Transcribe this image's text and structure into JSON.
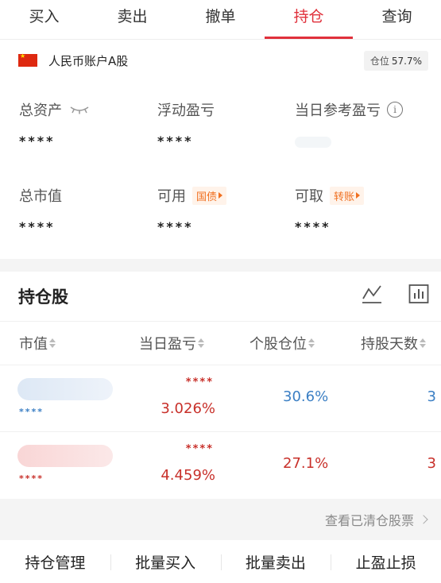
{
  "tabs": [
    {
      "label": "买入"
    },
    {
      "label": "卖出"
    },
    {
      "label": "撤单"
    },
    {
      "label": "持仓"
    },
    {
      "label": "查询"
    }
  ],
  "account": {
    "name": "人民币账户A股",
    "position_label": "仓位",
    "position_pct": "57.7%"
  },
  "assets": {
    "total_assets": {
      "label": "总资产",
      "value": "****"
    },
    "floating_pnl": {
      "label": "浮动盈亏",
      "value": "****"
    },
    "today_ref_pnl": {
      "label": "当日参考盈亏"
    },
    "market_value": {
      "label": "总市值",
      "value": "****"
    },
    "available": {
      "label": "可用",
      "tag": "国债",
      "value": "****"
    },
    "withdrawable": {
      "label": "可取",
      "tag": "转账",
      "value": "****"
    }
  },
  "holdings": {
    "title": "持仓股",
    "columns": [
      "市值",
      "当日盈亏",
      "个股仓位",
      "持股天数"
    ],
    "rows": [
      {
        "code": "****",
        "pnl_amount": "****",
        "pnl_pct": "3.026%",
        "position": "30.6%",
        "days": "3"
      },
      {
        "code": "****",
        "pnl_amount": "****",
        "pnl_pct": "4.459%",
        "position": "27.1%",
        "days": "3"
      }
    ],
    "cleared_link": "查看已清仓股票"
  },
  "actions": [
    "持仓管理",
    "批量买入",
    "批量卖出",
    "止盈止损"
  ],
  "colors": {
    "accent": "#e0303b",
    "profit": "#c8302a",
    "blue": "#3b7fc4",
    "tag": "#f07021"
  }
}
